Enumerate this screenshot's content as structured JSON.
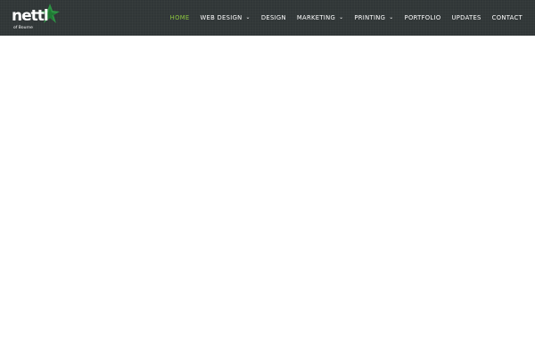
{
  "logo": {
    "wordmark": "nettl",
    "subtitle": "of Bourne",
    "mark_color": "#2e9e46"
  },
  "nav": {
    "items": [
      {
        "label": "HOME",
        "active": true,
        "has_dropdown": false
      },
      {
        "label": "WEB DESIGN",
        "active": false,
        "has_dropdown": true
      },
      {
        "label": "DESIGN",
        "active": false,
        "has_dropdown": false
      },
      {
        "label": "MARKETING",
        "active": false,
        "has_dropdown": true
      },
      {
        "label": "PRINTING",
        "active": false,
        "has_dropdown": true
      },
      {
        "label": "PORTFOLIO",
        "active": false,
        "has_dropdown": false
      },
      {
        "label": "UPDATES",
        "active": false,
        "has_dropdown": false
      },
      {
        "label": "CONTACT",
        "active": false,
        "has_dropdown": false
      }
    ],
    "active_color": "#8cc63f",
    "text_color": "#ffffff",
    "caret_icon": "chevron-down-icon"
  },
  "header": {
    "background_color": "#303637"
  }
}
